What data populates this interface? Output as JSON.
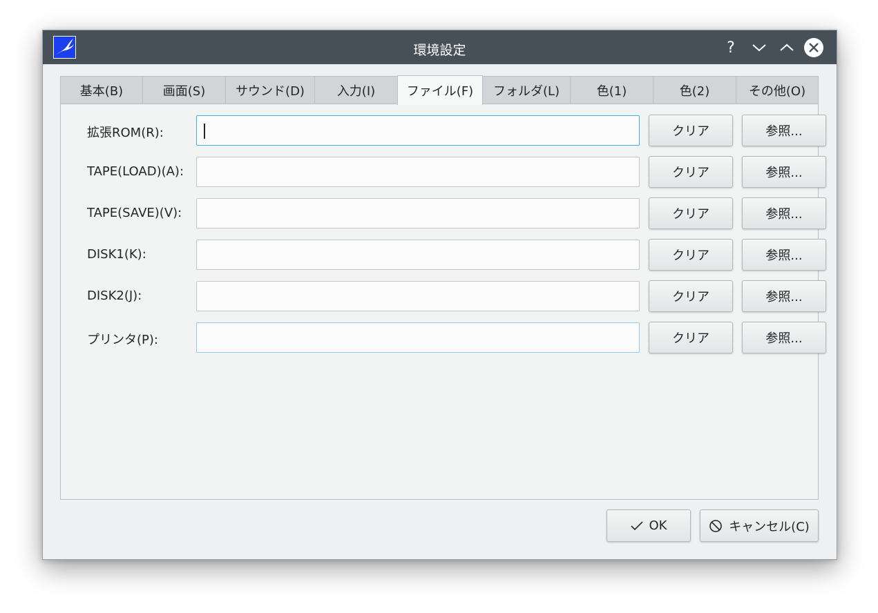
{
  "window": {
    "title": "環境設定",
    "app_icon": "bird-icon",
    "controls": [
      "help-icon",
      "minimize-icon",
      "maximize-icon",
      "close-icon"
    ],
    "help_glyph": "?"
  },
  "tabs": [
    {
      "label": "基本(B)"
    },
    {
      "label": "画面(S)"
    },
    {
      "label": "サウンド(D)"
    },
    {
      "label": "入力(I)"
    },
    {
      "label": "ファイル(F)",
      "active": true
    },
    {
      "label": "フォルダ(L)"
    },
    {
      "label": "色(1)"
    },
    {
      "label": "色(2)"
    },
    {
      "label": "その他(O)"
    }
  ],
  "files": {
    "clear_label": "クリア",
    "browse_label": "参照...",
    "rows": [
      {
        "label": "拡張ROM(R):",
        "value": ""
      },
      {
        "label": "TAPE(LOAD)(A):",
        "value": ""
      },
      {
        "label": "TAPE(SAVE)(V):",
        "value": ""
      },
      {
        "label": "DISK1(K):",
        "value": ""
      },
      {
        "label": "DISK2(J):",
        "value": ""
      },
      {
        "label": "プリンタ(P):",
        "value": ""
      }
    ]
  },
  "buttons": {
    "ok": {
      "label": "OK",
      "icon": "checkmark-icon"
    },
    "cancel": {
      "label": "キャンセル(C)",
      "icon": "cancel-icon"
    }
  },
  "colors": {
    "titlebar": "#475057",
    "focus": "#3daee9",
    "app_icon_bg": "#1a3ff0"
  }
}
